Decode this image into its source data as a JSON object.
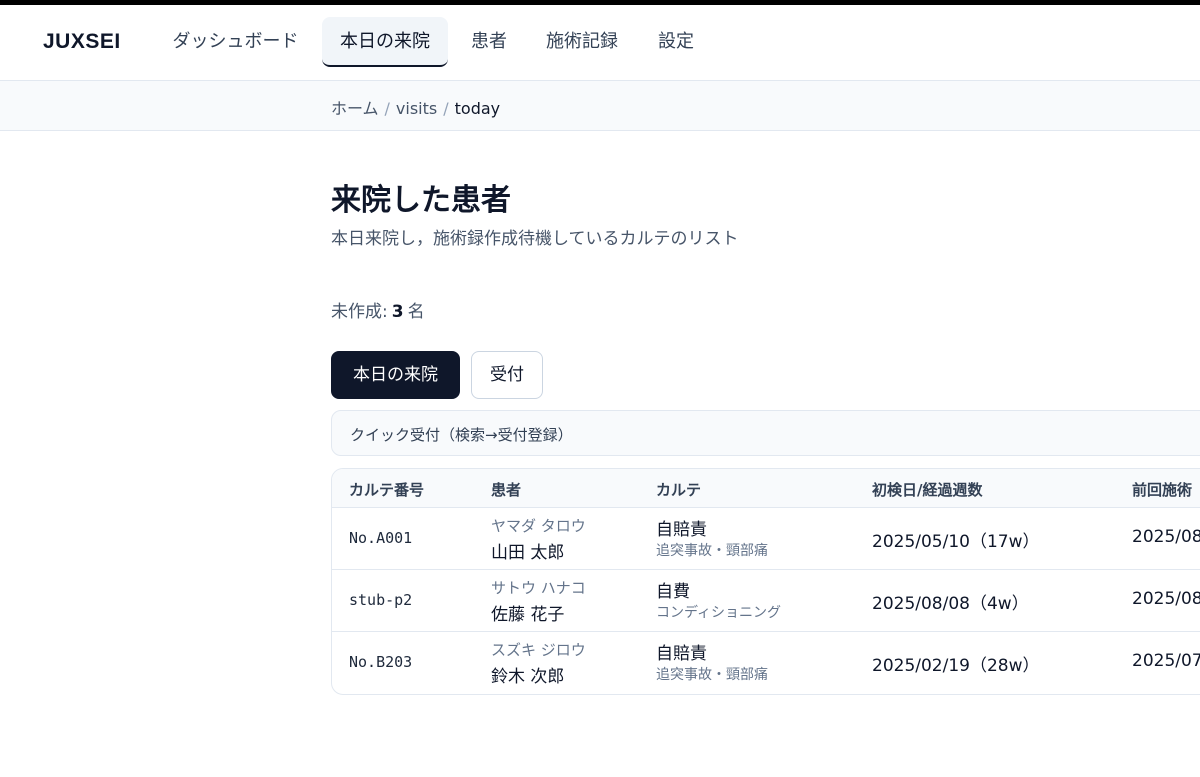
{
  "nav": {
    "brand": "JUXSEI",
    "items": [
      {
        "label": "ダッシュボード"
      },
      {
        "label": "本日の来院"
      },
      {
        "label": "患者"
      },
      {
        "label": "施術記録"
      },
      {
        "label": "設定"
      }
    ]
  },
  "breadcrumb": [
    "ホーム",
    "visits",
    "today"
  ],
  "page": {
    "title": "来院した患者",
    "subtitle": "本日来院し，施術録作成待機しているカルテのリスト",
    "count_label": "未作成:",
    "count_value": "3",
    "count_unit": "名"
  },
  "buttons": {
    "today": "本日の来院",
    "reception": "受付"
  },
  "quick": {
    "label": "クイック受付（検索→受付登録）"
  },
  "table": {
    "columns": [
      "カルテ番号",
      "患者",
      "カルテ",
      "初検日/経過週数",
      "前回施術"
    ],
    "rows": [
      {
        "chart_no": "No.A001",
        "kana": "ヤマダ タロウ",
        "name": "山田 太郎",
        "karte_type": "自賠責",
        "karte_desc": "追突事故・頸部痛",
        "first_visit": "2025/05/10（17w）",
        "prev_visit": "2025/08"
      },
      {
        "chart_no": "stub-p2",
        "kana": "サトウ ハナコ",
        "name": "佐藤 花子",
        "karte_type": "自費",
        "karte_desc": "コンディショニング",
        "first_visit": "2025/08/08（4w）",
        "prev_visit": "2025/08"
      },
      {
        "chart_no": "No.B203",
        "kana": "スズキ ジロウ",
        "name": "鈴木 次郎",
        "karte_type": "自賠責",
        "karte_desc": "追突事故・頸部痛",
        "first_visit": "2025/02/19（28w）",
        "prev_visit": "2025/07"
      }
    ]
  }
}
